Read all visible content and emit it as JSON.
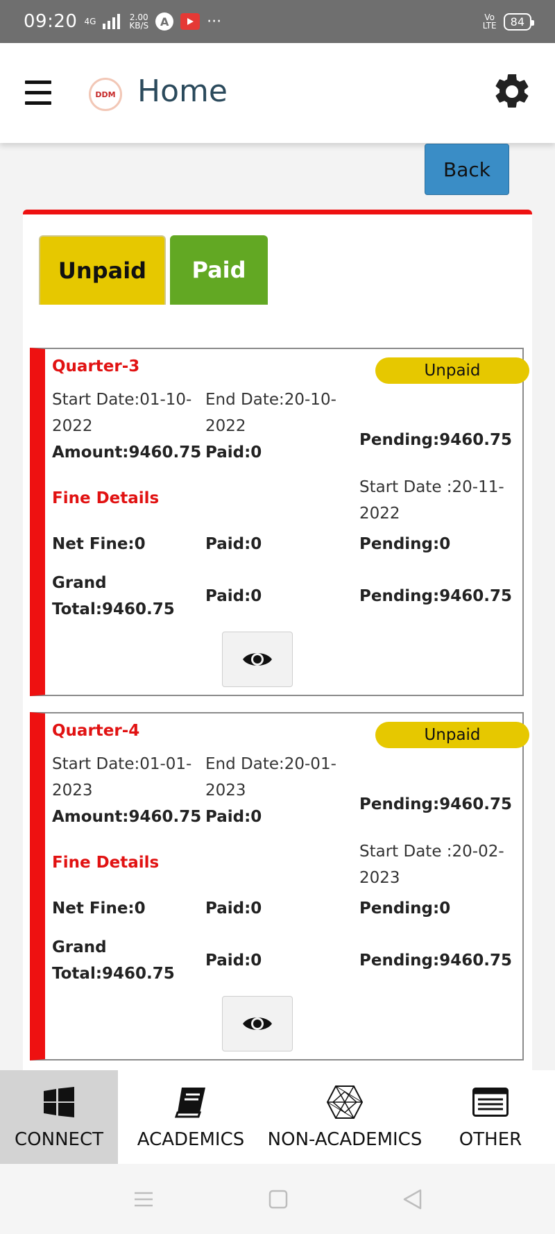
{
  "status_bar": {
    "time": "09:20",
    "network": "4G",
    "speed_value": "2.00",
    "speed_unit": "KB/S",
    "more": "···",
    "volte_top": "Vo",
    "volte_bottom": "LTE",
    "battery": "84"
  },
  "app_bar": {
    "title": "Home",
    "logo_text": "DDM"
  },
  "back_button": "Back",
  "tabs": [
    {
      "label": "Unpaid",
      "color": "#e6c800"
    },
    {
      "label": "Paid",
      "color": "#62a823"
    }
  ],
  "cards": [
    {
      "title": "Quarter-3",
      "status": "Unpaid",
      "start_date_1": "Start Date:01-10-",
      "start_date_2": "2022",
      "end_date_1": "End Date:20-10-",
      "end_date_2": "2022",
      "amount": "Amount:9460.75",
      "paid": "Paid:0",
      "pending": "Pending:9460.75",
      "fine_title": "Fine Details",
      "fine_start_1": "Start Date :20-11-",
      "fine_start_2": "2022",
      "net_fine": "Net Fine:0",
      "fine_paid": "Paid:0",
      "fine_pending": "Pending:0",
      "grand_1": "Grand",
      "grand_2": "Total:9460.75",
      "grand_paid": "Paid:0",
      "grand_pending": "Pending:9460.75"
    },
    {
      "title": "Quarter-4",
      "status": "Unpaid",
      "start_date_1": "Start Date:01-01-",
      "start_date_2": "2023",
      "end_date_1": "End Date:20-01-",
      "end_date_2": "2023",
      "amount": "Amount:9460.75",
      "paid": "Paid:0",
      "pending": "Pending:9460.75",
      "fine_title": "Fine Details",
      "fine_start_1": "Start Date :20-02-",
      "fine_start_2": "2023",
      "net_fine": "Net Fine:0",
      "fine_paid": "Paid:0",
      "fine_pending": "Pending:0",
      "grand_1": "Grand",
      "grand_2": "Total:9460.75",
      "grand_paid": "Paid:0",
      "grand_pending": "Pending:9460.75"
    }
  ],
  "bottom_nav": [
    {
      "label": "CONNECT",
      "icon": "windows-icon",
      "active": true
    },
    {
      "label": "ACADEMICS",
      "icon": "book-icon",
      "active": false
    },
    {
      "label": "NON-ACADEMICS",
      "icon": "polyhedron-icon",
      "active": false
    },
    {
      "label": "OTHER",
      "icon": "list-icon",
      "active": false
    }
  ],
  "colors": {
    "accent_red": "#ee1111",
    "unpaid_yellow": "#e6c800",
    "paid_green": "#62a823",
    "back_blue": "#3a8dc6",
    "title_blue": "#2b4a5c"
  }
}
